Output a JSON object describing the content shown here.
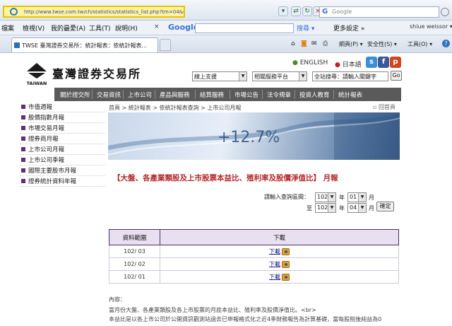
{
  "browser": {
    "url": "http://www.twse.com.tw/ch/statistics/statistics_list.php?tm=04&stm=001",
    "search_placeholder": "Google",
    "nav_back_label": "×",
    "refresh_label": "↻"
  },
  "menubar": {
    "items": [
      "檔案",
      "檢視(V)",
      "我的最愛(A)",
      "工具(T)",
      "說明(H)"
    ],
    "google_label": "Google",
    "search_button": "搜尋 ▾",
    "more_settings": "更多設定 »",
    "user": "shiue weissor ▾"
  },
  "tab": {
    "title": "TWSE 臺灣證券交易所：統計報表：依統計報表..."
  },
  "toolbar": {
    "page_label": "網頁(P) ▾",
    "security_label": "安全性(S) ▾",
    "tools_label": "工具(O) ▾",
    "help_label": "?"
  },
  "site": {
    "title": "臺灣證券交易所",
    "logo_text": "TAIWAN",
    "lang_en": "ENGLISH",
    "lang_jp": "日本語",
    "select_support": "線上支援",
    "select_platform": "相關服務平台",
    "search_scope": "全站搜尋：請輸入關鍵字",
    "search_go": "Go"
  },
  "mainnav": [
    "關於證交所",
    "交易資訊",
    "上市公司",
    "產品與服務",
    "結算服務",
    "市場公告",
    "法令規章",
    "投資人教育",
    "統計報表"
  ],
  "sidebar": [
    "市值週報",
    "股價指數月報",
    "市場交易月報",
    "證券商月報",
    "上市公司月報",
    "上市公司季報",
    "國際主要股市月報",
    "證券統計資料年報"
  ],
  "breadcrumb": "首頁 > 統計報表 > 依統計報表查詢 > 上市公司月報",
  "print_label": "回首頁",
  "banner_text": "+12.7%",
  "report_title": "【大盤、各產業類股及上市股票本益比、殖利率及股價淨值比】 月報",
  "query": {
    "label": "請輸入查詢區間：",
    "from_year": "102",
    "from_month": "01",
    "to_prefix": "至",
    "to_year": "102",
    "to_month": "04",
    "year_unit": "年",
    "month_unit": "月",
    "confirm": "確定"
  },
  "table": {
    "headers": [
      "資料範圍",
      "下載"
    ],
    "rows": [
      {
        "range": "102/ 03",
        "link": "下載"
      },
      {
        "range": "102/ 02",
        "link": "下載"
      },
      {
        "range": "102/ 01",
        "link": "下載"
      }
    ]
  },
  "content": {
    "label": "內容：",
    "line1": "當月份大盤、各產業類股及各上市股票的月底本益比、殖利率及股價淨值比。<br>",
    "line2": "本益比是以各上市公司於公開資訊觀測站過去已申報格式化之近4季財務報告為計算基礎，當每股稅後純益為0"
  }
}
